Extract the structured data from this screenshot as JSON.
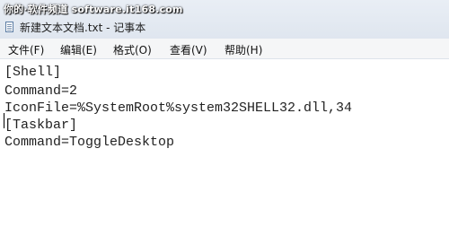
{
  "watermark": "你的·软件频道 software.it168.com",
  "window": {
    "title": "新建文本文档.txt - 记事本",
    "icon": "notepad-icon"
  },
  "menu": {
    "file": "文件(F)",
    "edit": "编辑(E)",
    "format": "格式(O)",
    "view": "查看(V)",
    "help": "帮助(H)"
  },
  "editor": {
    "lines": [
      "[Shell]",
      "Command=2",
      "IconFile=%SystemRoot%system32SHELL32.dll,34",
      "[Taskbar]",
      "Command=ToggleDesktop"
    ]
  }
}
